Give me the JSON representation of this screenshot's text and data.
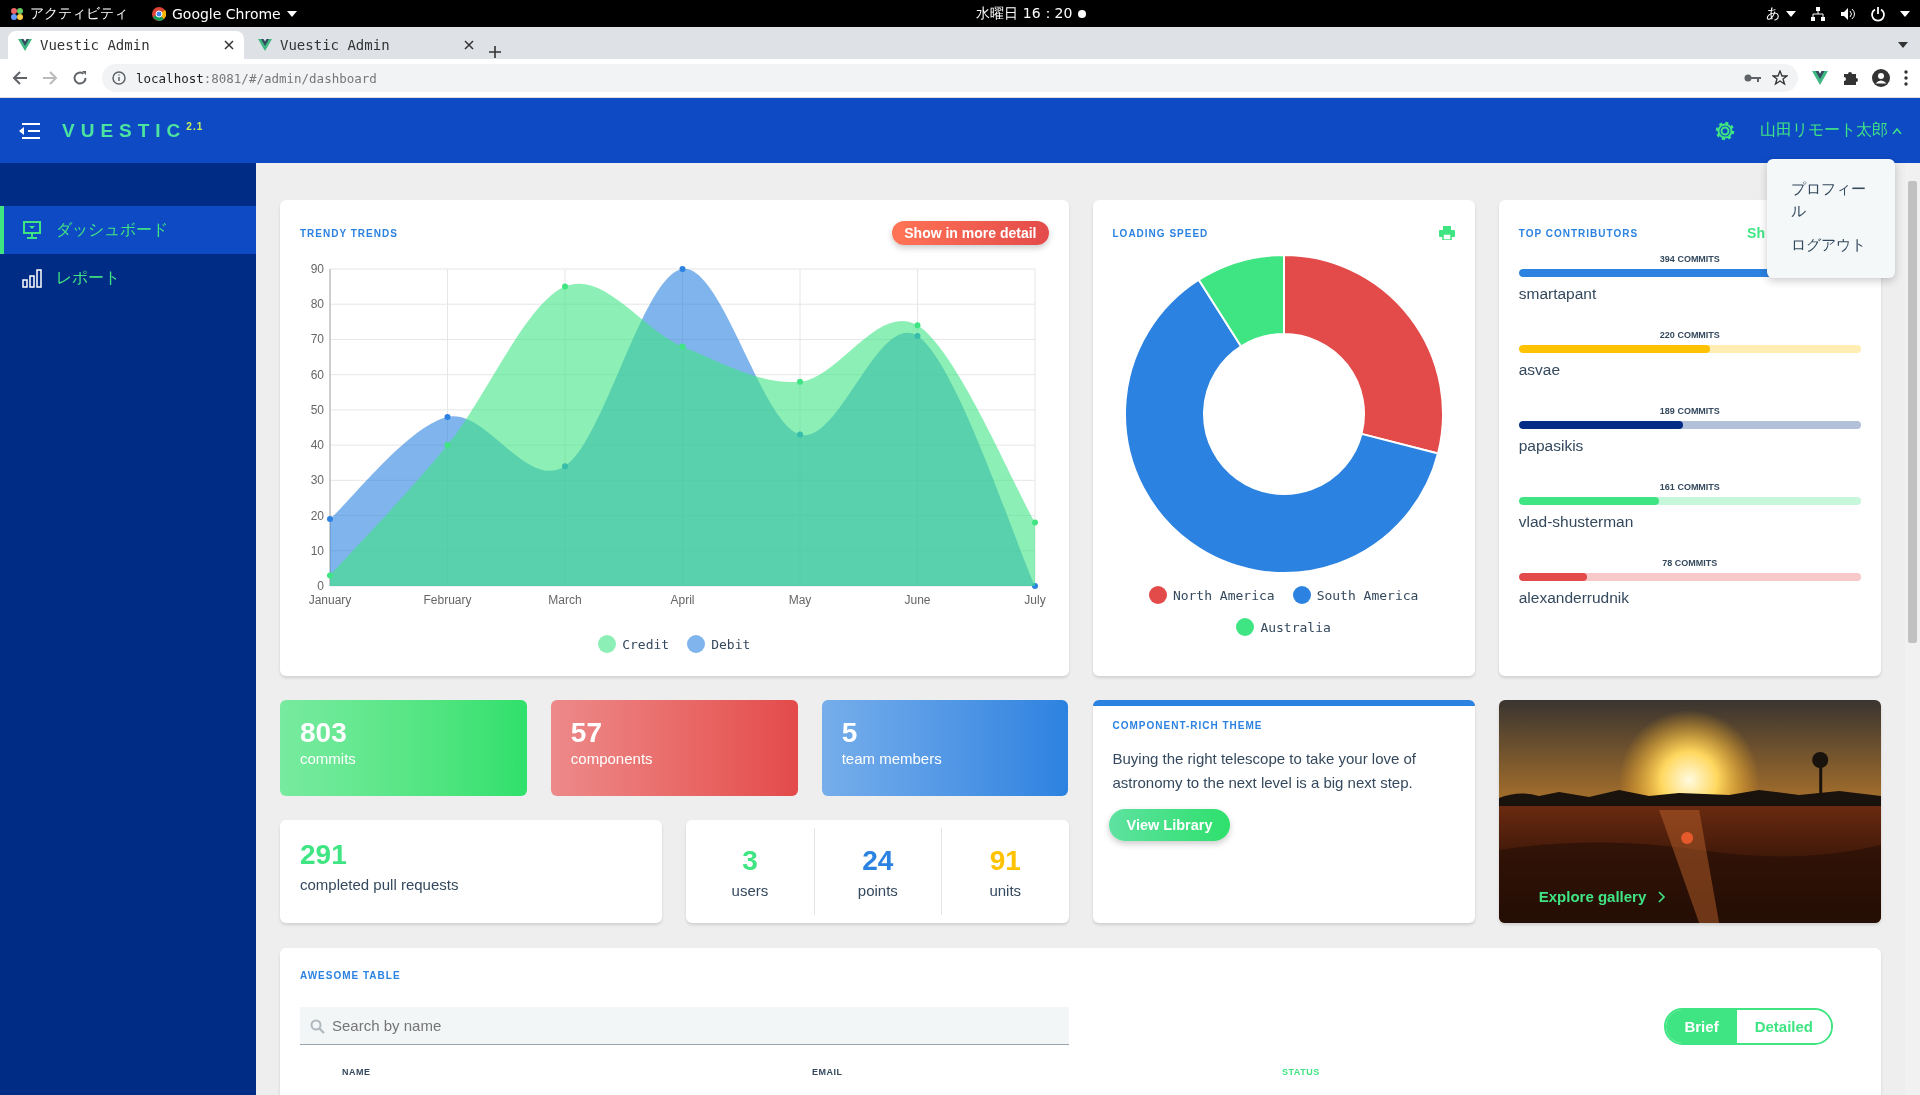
{
  "system_bar": {
    "activities": "アクティビティ",
    "app_menu": "Google Chrome",
    "clock": "水曜日 16：20",
    "input_method": "あ"
  },
  "browser": {
    "tabs": [
      {
        "title": "Vuestic Admin",
        "selected": true
      },
      {
        "title": "Vuestic Admin",
        "selected": false
      }
    ],
    "address": {
      "host": "localhost",
      "path": ":8081/#/admin/dashboard"
    }
  },
  "navbar": {
    "logo": "VUESTIC",
    "version": "2.1",
    "user": "山田リモート太郎",
    "menu_open": true
  },
  "user_menu": [
    "プロフィール",
    "ログアウト"
  ],
  "sidebar": {
    "items": [
      {
        "label": "ダッシュボード",
        "selected": true
      },
      {
        "label": "レポート",
        "selected": false
      }
    ]
  },
  "trends": {
    "title": "TRENDY TRENDS",
    "button": "Show in more detail",
    "chart_data": {
      "type": "area",
      "grid": true,
      "categories": [
        "January",
        "February",
        "March",
        "April",
        "May",
        "June",
        "July"
      ],
      "ylim": [
        0,
        90
      ],
      "yticks": [
        0,
        10,
        20,
        30,
        40,
        50,
        60,
        70,
        80,
        90
      ],
      "series": [
        {
          "name": "Debit",
          "color": "#2c82e0",
          "values": [
            19,
            48,
            34,
            90,
            43,
            71,
            0
          ]
        },
        {
          "name": "Credit",
          "color": "#40e583",
          "values": [
            3,
            40,
            85,
            68,
            58,
            74,
            18
          ]
        }
      ]
    }
  },
  "loading_speed": {
    "title": "LOADING SPEED",
    "legend": [
      {
        "label": "North America",
        "color": "#e34a4a"
      },
      {
        "label": "South America",
        "color": "#2c82e0"
      },
      {
        "label": "Australia",
        "color": "#40e583"
      }
    ]
  },
  "contributors": {
    "title": "TOP CONTRIBUTORS",
    "link": "Sh",
    "items": [
      {
        "name": "smartapant",
        "commits": "394 COMMITS",
        "level": 1,
        "color": "#2c82e0"
      },
      {
        "name": "asvae",
        "commits": "220 COMMITS",
        "level": 0.56,
        "color": "#ffc200"
      },
      {
        "name": "papasikis",
        "commits": "189 COMMITS",
        "level": 0.48,
        "color": "#002c85"
      },
      {
        "name": "vlad-shusterman",
        "commits": "161 COMMITS",
        "level": 0.41,
        "color": "#40e583"
      },
      {
        "name": "alexanderrudnik",
        "commits": "78 COMMITS",
        "level": 0.2,
        "color": "#e34a4a"
      }
    ]
  },
  "stats": [
    {
      "value": "803",
      "label": "commits",
      "color": "#2ee06c"
    },
    {
      "value": "57",
      "label": "components",
      "color": "#e34a4a"
    },
    {
      "value": "5",
      "label": "team members",
      "color": "#2c82e0"
    }
  ],
  "pull_requests": {
    "value": "291",
    "label": "completed pull requests"
  },
  "counts": [
    {
      "value": "3",
      "label": "users",
      "color": "#40e583"
    },
    {
      "value": "24",
      "label": "points",
      "color": "#2c82e0"
    },
    {
      "value": "91",
      "label": "units",
      "color": "#ffc200"
    }
  ],
  "theme": {
    "title": "COMPONENT-RICH THEME",
    "text": "Buying the right telescope to take your love of astronomy to the next level is a big next step.",
    "button": "View Library"
  },
  "gallery": {
    "kind": "picture",
    "link": "Explore gallery"
  },
  "table": {
    "title": "AWESOME TABLE",
    "search": {
      "placeholder": "Search by name"
    },
    "modes": [
      {
        "label": "Brief",
        "selected": true
      },
      {
        "label": "Detailed",
        "selected": false
      }
    ],
    "columns": [
      {
        "label": "NAME",
        "sorted": false
      },
      {
        "label": "EMAIL",
        "sorted": false
      },
      {
        "label": "STATUS",
        "sorted": true
      }
    ]
  }
}
